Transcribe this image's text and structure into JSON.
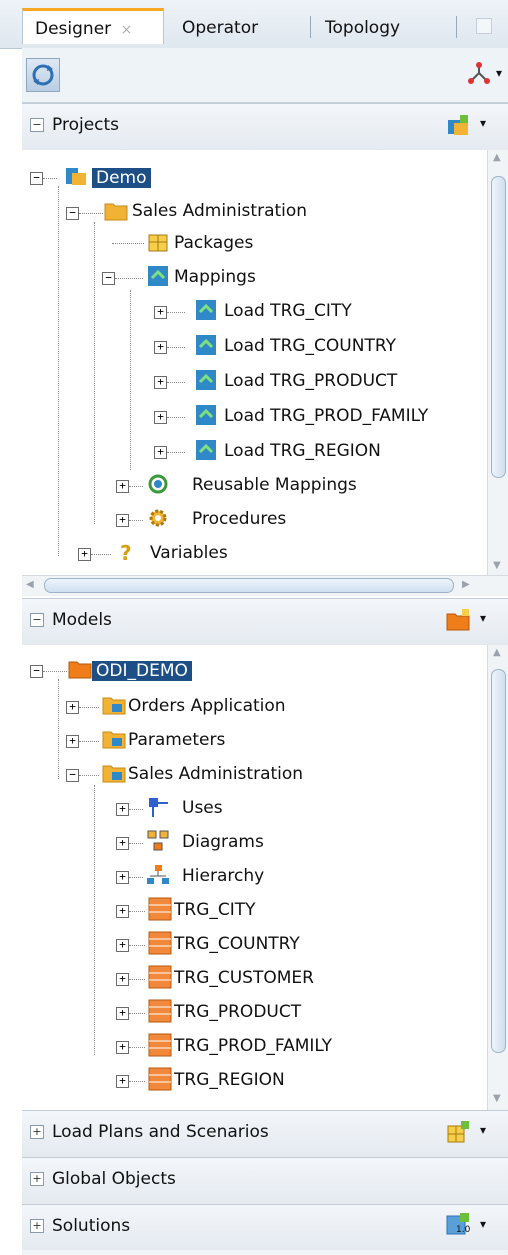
{
  "tabs": [
    {
      "label": "Designer",
      "close": "×"
    },
    {
      "label": "Operator"
    },
    {
      "label": "Topology"
    }
  ],
  "sections": {
    "projects": {
      "label": "Projects",
      "expander": "−"
    },
    "models": {
      "label": "Models",
      "expander": "−"
    },
    "load_plans": {
      "label": "Load Plans and Scenarios",
      "expander": "+"
    },
    "global_objects": {
      "label": "Global Objects",
      "expander": "+"
    },
    "solutions": {
      "label": "Solutions",
      "expander": "+"
    }
  },
  "projects_tree": {
    "root": "Demo",
    "folder": "Sales Administration",
    "packages": "Packages",
    "mappings": "Mappings",
    "mapping_items": [
      "Load TRG_CITY",
      "Load TRG_COUNTRY",
      "Load TRG_PRODUCT",
      "Load TRG_PROD_FAMILY",
      "Load TRG_REGION"
    ],
    "reusable": "Reusable Mappings",
    "procedures": "Procedures",
    "variables": "Variables"
  },
  "models_tree": {
    "root": "ODI_DEMO",
    "orders": "Orders Application",
    "parameters": "Parameters",
    "sales": "Sales Administration",
    "uses": "Uses",
    "diagrams": "Diagrams",
    "hierarchy": "Hierarchy",
    "datastores": [
      "TRG_CITY",
      "TRG_COUNTRY",
      "TRG_CUSTOMER",
      "TRG_PRODUCT",
      "TRG_PROD_FAMILY",
      "TRG_REGION"
    ]
  },
  "solutions_badge": "1.0",
  "colors": {
    "selection": "#1d4f86",
    "tab_accent": "#f5a623",
    "folder": "#f2b233",
    "model": "#ef7d1a",
    "mapping": "#2f88c8"
  }
}
